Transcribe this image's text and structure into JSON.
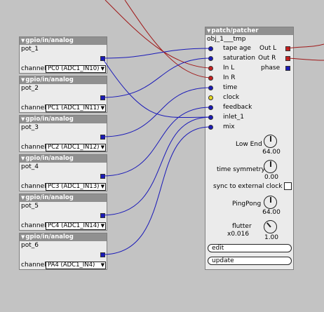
{
  "gpio_objects": [
    {
      "type": "gpio/in/analog",
      "name": "pot_1",
      "channel_label": "channel",
      "channel_value": "PC0 (ADC1_IN10)"
    },
    {
      "type": "gpio/in/analog",
      "name": "pot_2",
      "channel_label": "channel",
      "channel_value": "PC1 (ADC1_IN11)"
    },
    {
      "type": "gpio/in/analog",
      "name": "pot_3",
      "channel_label": "channel",
      "channel_value": "PC2 (ADC1_IN12)"
    },
    {
      "type": "gpio/in/analog",
      "name": "pot_4",
      "channel_label": "channel",
      "channel_value": "PC3 (ADC1_IN13)"
    },
    {
      "type": "gpio/in/analog",
      "name": "pot_5",
      "channel_label": "channel",
      "channel_value": "PC4 (ADC1_IN14)"
    },
    {
      "type": "gpio/in/analog",
      "name": "pot_6",
      "channel_label": "channel",
      "channel_value": "PA4 (ADC1_IN4)"
    }
  ],
  "patcher": {
    "type": "patch/patcher",
    "name": "obj_1___tmp",
    "inlets": [
      {
        "label": "tape age",
        "color": "blue"
      },
      {
        "label": "saturation",
        "color": "blue"
      },
      {
        "label": "In L",
        "color": "red"
      },
      {
        "label": "In R",
        "color": "red"
      },
      {
        "label": "time",
        "color": "blue"
      },
      {
        "label": "clock",
        "color": "yellow"
      },
      {
        "label": "feedback",
        "color": "blue"
      },
      {
        "label": "inlet_1",
        "color": "blue"
      },
      {
        "label": "mix",
        "color": "blue"
      }
    ],
    "outlets": [
      {
        "label": "Out L",
        "color": "red"
      },
      {
        "label": "Out R",
        "color": "red"
      },
      {
        "label": "phase",
        "color": "blue"
      }
    ],
    "low_end": {
      "label": "Low End",
      "value": "64.00"
    },
    "time_symmetry": {
      "label": "time symmetry",
      "value": "0.00"
    },
    "sync": {
      "label": "sync to external clock"
    },
    "pingpong": {
      "label": "PingPong",
      "value": "64.00"
    },
    "flutter": {
      "label": "flutter",
      "sublabel": "x0.016",
      "value": "1.00"
    },
    "edit_label": "edit",
    "update_label": "update"
  },
  "colors": {
    "background": "#c3c3c3",
    "blue_wire": "#1a1ab8",
    "red_wire": "#a01818",
    "header": "#909090"
  }
}
